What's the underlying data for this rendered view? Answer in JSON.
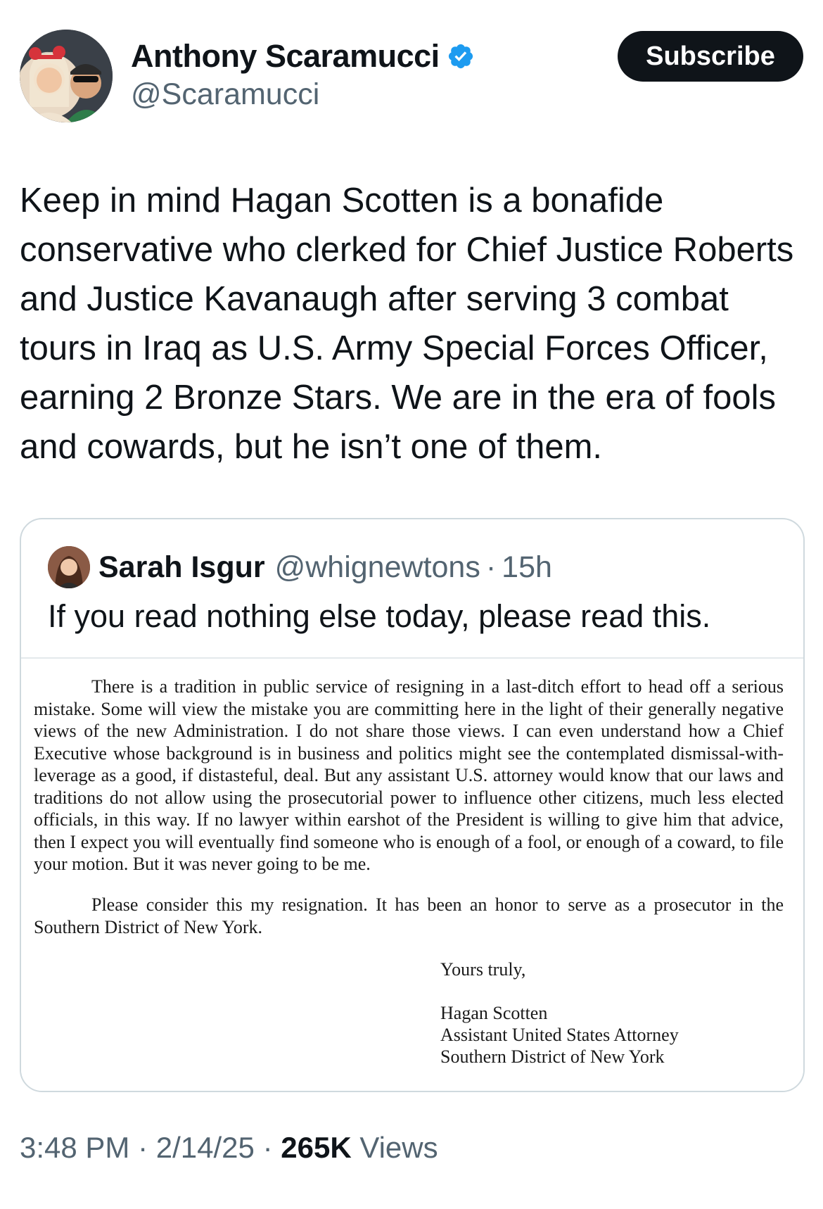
{
  "author": {
    "display_name": "Anthony Scaramucci",
    "handle": "@Scaramucci",
    "verified": true
  },
  "subscribe_label": "Subscribe",
  "tweet_text": "Keep in mind Hagan Scotten is a bonafide conservative who clerked for Chief Justice Roberts and Justice Kavanaugh after serving 3 combat tours in Iraq as U.S. Army Special Forces Officer, earning 2 Bronze Stars. We are in the era of fools and cowards, but he isn’t one of them.",
  "quoted": {
    "display_name": "Sarah Isgur",
    "handle": "@whignewtons",
    "separator": "·",
    "time_ago": "15h",
    "text": "If you read nothing else today, please read this.",
    "letter": {
      "paragraph1": "There is a tradition in public service of resigning in a last-ditch effort to head off a serious mistake.  Some will view the mistake you are committing here in the light of their generally negative views of the new Administration.  I do not share those views.  I can even understand how a Chief Executive whose background is in business and politics might see the contemplated dismissal-with-leverage as a good, if distasteful, deal.  But any assistant U.S. attorney would know that our laws and traditions do not allow using the prosecutorial power to influence other citizens, much less elected officials, in this way.  If no lawyer within earshot of the President is willing to give him that advice, then I expect you will eventually find someone who is enough of a fool, or enough of a coward, to file your motion.  But it was never going to be me.",
      "paragraph2": "Please consider this my resignation.  It has been an honor to serve as a prosecutor in the Southern District of New York.",
      "closing": "Yours truly,",
      "signer_name": "Hagan Scotten",
      "signer_title": "Assistant United States Attorney",
      "signer_office": "Southern District of New York"
    }
  },
  "meta": {
    "time": "3:48 PM",
    "date": "2/14/25",
    "separator": "·",
    "views_count": "265K",
    "views_label": "Views"
  },
  "colors": {
    "text_primary": "#0f1419",
    "text_secondary": "#536471",
    "verified_blue": "#1d9bf0",
    "border": "#cfd9de"
  }
}
